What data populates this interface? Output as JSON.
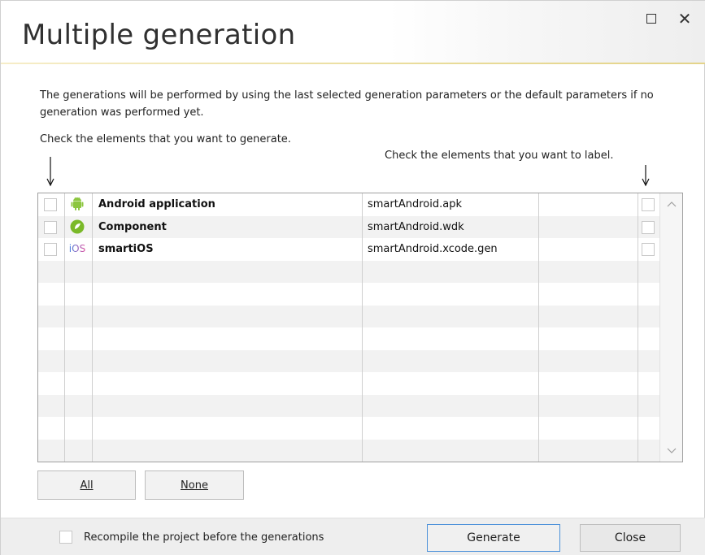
{
  "window": {
    "title": "Multiple generation"
  },
  "description": "The generations will be performed by using the last selected generation parameters or the default parameters if no generation was performed yet.",
  "hints": {
    "generate": "Check the elements that you want to generate.",
    "label": "Check the elements that you want to label."
  },
  "grid": {
    "rows": [
      {
        "name": "Android application",
        "file": "smartAndroid.apk",
        "icon": "android-icon",
        "generate_checked": false,
        "label_checked": false
      },
      {
        "name": "Component",
        "file": "smartAndroid.wdk",
        "icon": "component-icon",
        "generate_checked": false,
        "label_checked": false
      },
      {
        "name": "smartiOS",
        "file": "smartAndroid.xcode.gen",
        "icon": "ios-icon",
        "icon_text": "iOS",
        "generate_checked": false,
        "label_checked": false
      }
    ]
  },
  "buttons": {
    "all": "All",
    "none": "None",
    "generate": "Generate",
    "close": "Close"
  },
  "footer": {
    "recompile_label": "Recompile the project before the generations",
    "recompile_checked": false
  },
  "colors": {
    "accent_border": "#4a90d9",
    "android_green": "#8cc63f",
    "component_green": "#7ab929",
    "ios_blue": "#3f7fe0",
    "ios_pink": "#e050a0"
  }
}
